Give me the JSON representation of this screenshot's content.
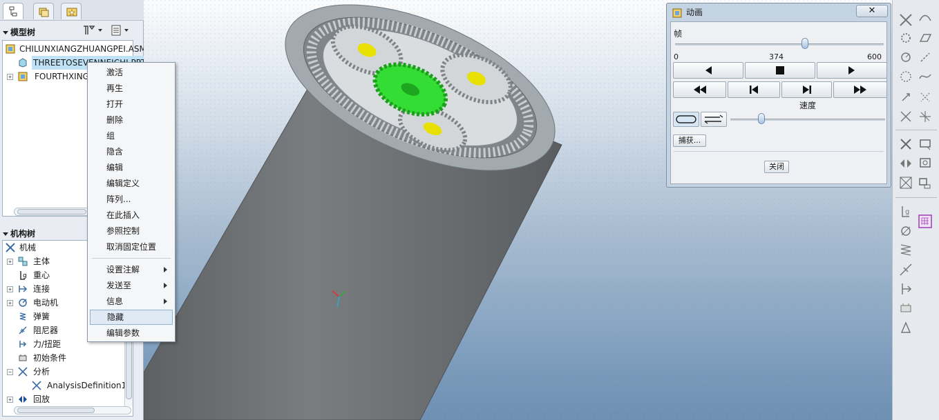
{
  "left_panel": {
    "model_tree": {
      "header": "模型树",
      "items": [
        {
          "label": "CHILUNXIANGZHUANGPEI.ASM"
        },
        {
          "label": "THREETOSEVENNEICHI.PRT"
        },
        {
          "label": "FOURTHXINGXING"
        }
      ]
    },
    "mechanism_tree": {
      "header": "机构树",
      "root": "机械",
      "items": [
        {
          "label": "主体"
        },
        {
          "label": "重心"
        },
        {
          "label": "连接"
        },
        {
          "label": "电动机"
        },
        {
          "label": "弹簧"
        },
        {
          "label": "阻尼器"
        },
        {
          "label": "力/扭距"
        },
        {
          "label": "初始条件"
        },
        {
          "label": "分析"
        },
        {
          "label": "AnalysisDefinition1"
        },
        {
          "label": "回放"
        }
      ]
    }
  },
  "context_menu": {
    "items": [
      {
        "label": "激活"
      },
      {
        "label": "再生"
      },
      {
        "label": "打开"
      },
      {
        "label": "删除"
      },
      {
        "label": "组"
      },
      {
        "label": "隐含"
      },
      {
        "label": "编辑"
      },
      {
        "label": "编辑定义"
      },
      {
        "label": "阵列..."
      },
      {
        "label": "在此插入"
      },
      {
        "label": "参照控制"
      },
      {
        "label": "取消固定位置"
      }
    ],
    "submenu_items": [
      {
        "label": "设置注解"
      },
      {
        "label": "发送至"
      },
      {
        "label": "信息"
      }
    ],
    "highlighted_item": "隐藏",
    "last_item": "编辑参数"
  },
  "animation_dialog": {
    "title": "动画",
    "close_glyph": "✕",
    "frame_label": "帧",
    "frame_min": "0",
    "frame_current": "374",
    "frame_max": "600",
    "frame_progress": 0.623,
    "speed_label": "速度",
    "speed_level": 0.2,
    "capture_button": "捕获...",
    "close_button": "关闭"
  },
  "viewport": {
    "gear_color": "#33dd33",
    "planet_center_color": "#e8e000",
    "housing_color": "#6e7073"
  }
}
